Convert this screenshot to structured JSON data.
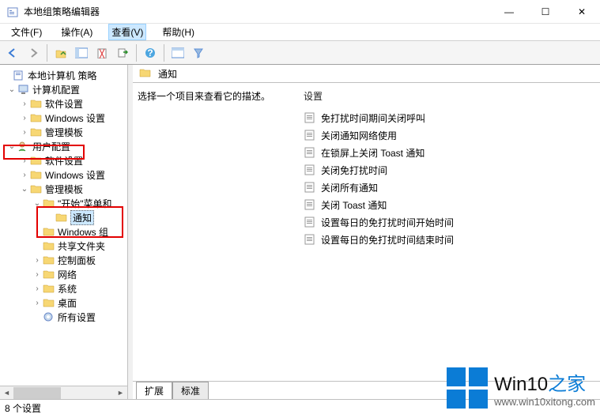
{
  "window": {
    "title": "本地组策略编辑器",
    "min": "—",
    "max": "☐",
    "close": "✕"
  },
  "menu": {
    "file": "文件(F)",
    "action": "操作(A)",
    "view": "查看(V)",
    "help": "帮助(H)"
  },
  "tree": {
    "root": "本地计算机 策略",
    "computer_config": "计算机配置",
    "cc_software": "软件设置",
    "cc_windows": "Windows 设置",
    "cc_admin": "管理模板",
    "user_config": "用户配置",
    "uc_software": "软件设置",
    "uc_windows": "Windows 设置",
    "uc_admin": "管理模板",
    "start_menu": "\"开始\"菜单和",
    "notifications": "通知",
    "win_components": "Windows 组",
    "shared_folders": "共享文件夹",
    "control_panel": "控制面板",
    "network": "网络",
    "system": "系统",
    "desktop": "桌面",
    "all_settings": "所有设置"
  },
  "content": {
    "header_title": "通知",
    "desc_hint": "选择一个项目来查看它的描述。",
    "setting_col": "设置",
    "settings": [
      "免打扰时间期间关闭呼叫",
      "关闭通知网络使用",
      "在锁屏上关闭 Toast 通知",
      "关闭免打扰时间",
      "关闭所有通知",
      "关闭 Toast 通知",
      "设置每日的免打扰时间开始时间",
      "设置每日的免打扰时间结束时间"
    ],
    "tabs": {
      "extended": "扩展",
      "standard": "标准"
    }
  },
  "status": "8 个设置",
  "watermark": {
    "brand": "Win10",
    "suffix": "之家",
    "url": "www.win10xitong.com"
  }
}
